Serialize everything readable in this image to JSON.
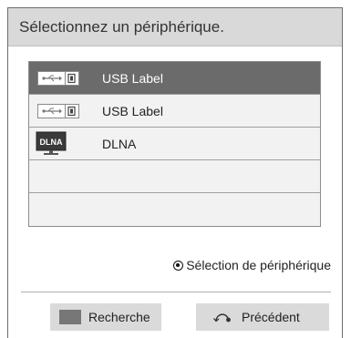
{
  "dialog": {
    "title": "Sélectionnez un périphérique."
  },
  "devices": [
    {
      "label": "USB Label",
      "icon": "usb-drive-icon",
      "selected": true
    },
    {
      "label": "USB Label",
      "icon": "usb-drive-icon",
      "selected": false
    },
    {
      "label": "DLNA",
      "icon": "dlna-monitor-icon",
      "icon_text": "DLNA",
      "selected": false
    },
    {
      "label": "",
      "selected": false
    },
    {
      "label": "",
      "selected": false
    }
  ],
  "legend": {
    "label": "Sélection de périphérique",
    "icon": "ok-radio-icon"
  },
  "buttons": {
    "search_label": "Recherche",
    "search_color": "#777777",
    "back_label": "Précédent",
    "back_icon": "back-arrow-icon"
  },
  "colors": {
    "title_bar": "#d9d9d9",
    "selected_row": "#6b6b6b",
    "row": "#f2f2f2"
  }
}
